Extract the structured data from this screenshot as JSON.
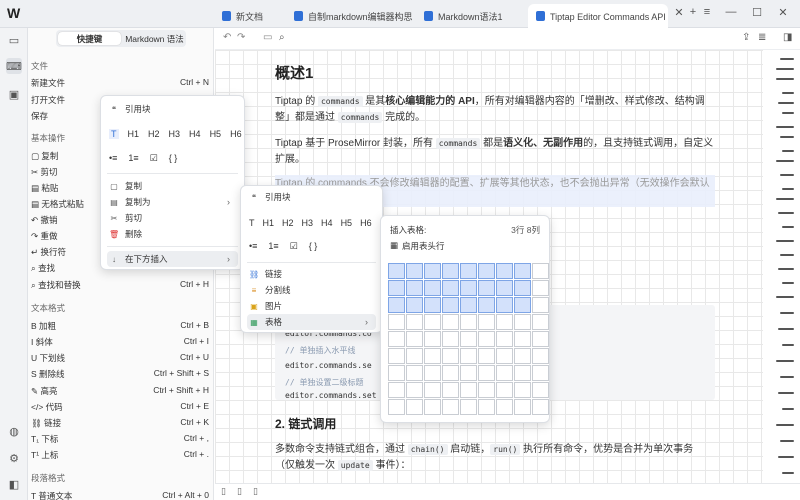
{
  "app": {
    "logo": "W"
  },
  "tabs": [
    {
      "label": "新文档"
    },
    {
      "label": "自制markdown编辑器构思"
    },
    {
      "label": "Markdown语法1"
    },
    {
      "label": "Tiptap Editor Commands API 参考"
    }
  ],
  "window": {
    "add": "+",
    "list": "≡",
    "min": "—",
    "max": "☐",
    "close": "✕"
  },
  "sidebar": {
    "seg_shortcuts": "快捷键",
    "seg_markdown": "Markdown 语法",
    "sections": [
      {
        "title": "文件",
        "items": [
          {
            "label": "新建文件",
            "key": "Ctrl + N"
          },
          {
            "label": "打开文件",
            "key": ""
          },
          {
            "label": "保存",
            "key": ""
          }
        ]
      },
      {
        "title": "基本操作",
        "items": [
          {
            "label": "复制",
            "key": ""
          },
          {
            "label": "剪切",
            "key": ""
          },
          {
            "label": "粘贴",
            "key": ""
          },
          {
            "label": "无格式粘贴",
            "key": ""
          },
          {
            "label": "撤销",
            "key": ""
          },
          {
            "label": "重做",
            "key": ""
          },
          {
            "label": "换行符",
            "key": ""
          },
          {
            "label": "查找",
            "key": ""
          },
          {
            "label": "查找和替换",
            "key": "Ctrl + H"
          }
        ]
      },
      {
        "title": "文本格式",
        "items": [
          {
            "label": "加粗",
            "key": "Ctrl + B"
          },
          {
            "label": "斜体",
            "key": "Ctrl + I"
          },
          {
            "label": "下划线",
            "key": "Ctrl + U"
          },
          {
            "label": "删除线",
            "key": "Ctrl + Shift + S"
          },
          {
            "label": "高亮",
            "key": "Ctrl + Shift + H"
          },
          {
            "label": "代码",
            "key": "Ctrl + E"
          },
          {
            "label": "链接",
            "key": "Ctrl + K"
          },
          {
            "label": "下标",
            "key": "Ctrl + ,"
          },
          {
            "label": "上标",
            "key": "Ctrl + ."
          }
        ]
      },
      {
        "title": "段落格式",
        "items": [
          {
            "label": "普通文本",
            "key": "Ctrl + Alt + 0"
          }
        ]
      }
    ]
  },
  "editor": {
    "h1": "概述1",
    "p1a": "Tiptap 的 ",
    "p1code1": "commands",
    "p1b": " 是其",
    "p1bold": "核心编辑能力的 API",
    "p1c": "，所有对编辑器内容的「增删改、样式修改、结构调整」都是通过 ",
    "p1code2": "commands",
    "p1d": " 完成的。",
    "p2a": "Tiptap 基于 ProseMirror 封装，所有 ",
    "p2code": "commands",
    "p2b": " 都是",
    "p2bold": "语义化、无副作用",
    "p2c": "的，且支持链式调用，自定义扩展。",
    "p3": "Tiptap 的 commands 不会修改编辑器的配置、扩展等其他状态，也不会抛出异常（无效操作会默认",
    "code_lines": [
      "editor.commands.co",
      "// 单独插入水平线",
      "editor.commands.se",
      "// 单独设置二级标题",
      "editor.commands.set"
    ],
    "h2": "2. 链式调用",
    "p4a": "多数命令支持链式组合，通过 ",
    "p4code1": "chain()",
    "p4b": " 启动链，",
    "p4code2": "run()",
    "p4c": " 执行所有命令，优势是合并为单次事务",
    "p5a": "（仅触发一次 ",
    "p5code": "update",
    "p5b": " 事件）："
  },
  "menu1": {
    "quote": "引用块",
    "headings": [
      "T",
      "H1",
      "H2",
      "H3",
      "H4",
      "H5",
      "H6"
    ],
    "lists": [
      "•≡",
      "1≡",
      "☑",
      "{ }"
    ],
    "copy": "复制",
    "copy_as": "复制为",
    "cut": "剪切",
    "delete": "删除",
    "insert_below": "在下方插入"
  },
  "menu2": {
    "quote": "引用块",
    "headings": [
      "T",
      "H1",
      "H2",
      "H3",
      "H4",
      "H5",
      "H6"
    ],
    "lists": [
      "•≡",
      "1≡",
      "☑",
      "{ }"
    ],
    "link": "链接",
    "divider": "分割线",
    "image": "图片",
    "table": "表格"
  },
  "table_picker": {
    "title": "插入表格:",
    "size": "3行 8列",
    "header_toggle": "启用表头行",
    "rows": 9,
    "cols": 9,
    "selected_rows": 3,
    "selected_cols": 8
  }
}
